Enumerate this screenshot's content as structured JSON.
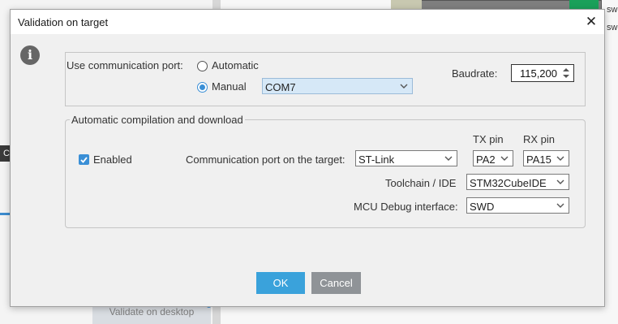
{
  "background": {
    "sw_labels": [
      "sw",
      "sw"
    ],
    "side_tab": "C",
    "validate_button": "Validate on desktop"
  },
  "dialog": {
    "title": "Validation on target",
    "close_icon": "close-icon",
    "info_icon": "info-icon"
  },
  "port": {
    "label": "Use communication port:",
    "automatic_label": "Automatic",
    "manual_label": "Manual",
    "selected_mode": "Manual",
    "port_value": "COM7",
    "baudrate_label": "Baudrate:",
    "baudrate_value": "115,200"
  },
  "auto": {
    "legend": "Automatic compilation and download",
    "enabled_label": "Enabled",
    "enabled_checked": true,
    "tx_header": "TX pin",
    "rx_header": "RX pin",
    "comm_port_label": "Communication port on the target:",
    "comm_port_value": "ST-Link",
    "tx_value": "PA2",
    "rx_value": "PA15",
    "toolchain_label": "Toolchain / IDE",
    "toolchain_value": "STM32CubeIDE",
    "debug_label": "MCU Debug interface:",
    "debug_value": "SWD"
  },
  "buttons": {
    "ok": "OK",
    "cancel": "Cancel"
  },
  "colors": {
    "accent": "#3a8fd6",
    "ok_button": "#3aa2db",
    "cancel_button": "#8f9397",
    "highlight_field": "#d6e8f7"
  }
}
